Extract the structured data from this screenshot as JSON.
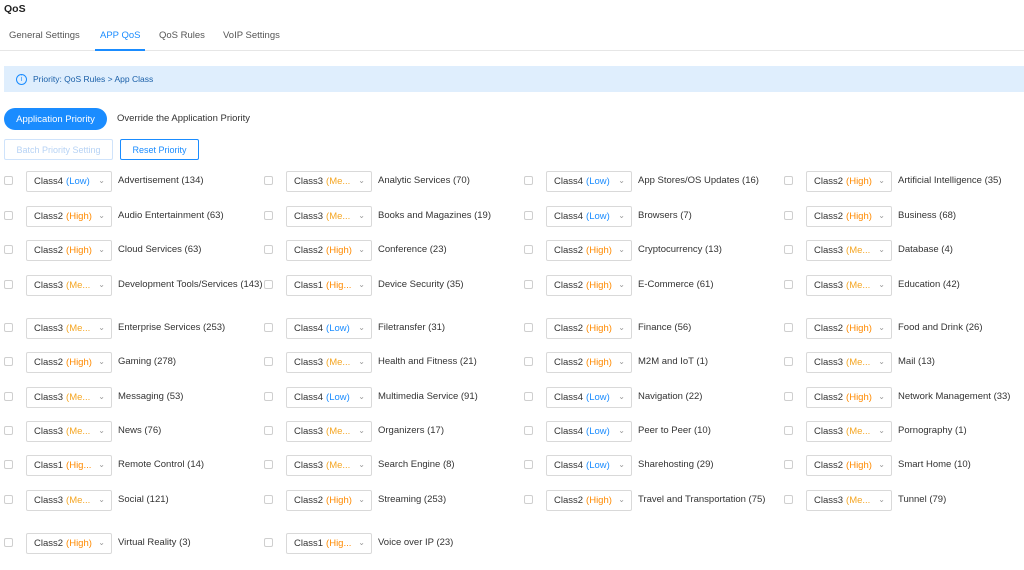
{
  "page_title": "QoS",
  "tabs": [
    {
      "label": "General Settings",
      "active": false
    },
    {
      "label": "APP QoS",
      "active": true
    },
    {
      "label": "QoS Rules",
      "active": false
    },
    {
      "label": "VoIP Settings",
      "active": false
    }
  ],
  "info": {
    "icon": "info-circle-icon",
    "text": "Priority: QoS Rules > App Class"
  },
  "mode": {
    "active": "Application Priority",
    "other": "Override the Application Priority"
  },
  "buttons": {
    "batch": "Batch Priority Setting",
    "reset": "Reset Priority"
  },
  "priority_colors": {
    "High": "#ff8a00",
    "Medium": "#f5a623",
    "Low": "#1a8cff"
  },
  "apps": [
    {
      "cls": "Class4",
      "pri": "Low",
      "pri_text": "(Low)",
      "name": "Advertisement (134)"
    },
    {
      "cls": "Class3",
      "pri": "Medium",
      "pri_text": "(Me...",
      "name": "Analytic Services (70)"
    },
    {
      "cls": "Class4",
      "pri": "Low",
      "pri_text": "(Low)",
      "name": "App Stores/OS Updates (16)"
    },
    {
      "cls": "Class2",
      "pri": "High",
      "pri_text": "(High)",
      "name": "Artificial Intelligence (35)"
    },
    {
      "cls": "Class2",
      "pri": "High",
      "pri_text": "(High)",
      "name": "Audio Entertainment (63)"
    },
    {
      "cls": "Class3",
      "pri": "Medium",
      "pri_text": "(Me...",
      "name": "Books and Magazines (19)"
    },
    {
      "cls": "Class4",
      "pri": "Low",
      "pri_text": "(Low)",
      "name": "Browsers (7)"
    },
    {
      "cls": "Class2",
      "pri": "High",
      "pri_text": "(High)",
      "name": "Business (68)"
    },
    {
      "cls": "Class2",
      "pri": "High",
      "pri_text": "(High)",
      "name": "Cloud Services (63)"
    },
    {
      "cls": "Class2",
      "pri": "High",
      "pri_text": "(High)",
      "name": "Conference (23)"
    },
    {
      "cls": "Class2",
      "pri": "High",
      "pri_text": "(High)",
      "name": "Cryptocurrency (13)"
    },
    {
      "cls": "Class3",
      "pri": "Medium",
      "pri_text": "(Me...",
      "name": "Database (4)"
    },
    {
      "cls": "Class3",
      "pri": "Medium",
      "pri_text": "(Me...",
      "name": "Development Tools/Services (143)"
    },
    {
      "cls": "Class1",
      "pri": "High",
      "pri_text": "(Hig...",
      "name": "Device Security (35)"
    },
    {
      "cls": "Class2",
      "pri": "High",
      "pri_text": "(High)",
      "name": "E-Commerce (61)"
    },
    {
      "cls": "Class3",
      "pri": "Medium",
      "pri_text": "(Me...",
      "name": "Education (42)"
    },
    {
      "cls": "Class3",
      "pri": "Medium",
      "pri_text": "(Me...",
      "name": "Enterprise Services (253)"
    },
    {
      "cls": "Class4",
      "pri": "Low",
      "pri_text": "(Low)",
      "name": "Filetransfer (31)"
    },
    {
      "cls": "Class2",
      "pri": "High",
      "pri_text": "(High)",
      "name": "Finance (56)"
    },
    {
      "cls": "Class2",
      "pri": "High",
      "pri_text": "(High)",
      "name": "Food and Drink (26)"
    },
    {
      "cls": "Class2",
      "pri": "High",
      "pri_text": "(High)",
      "name": "Gaming (278)"
    },
    {
      "cls": "Class3",
      "pri": "Medium",
      "pri_text": "(Me...",
      "name": "Health and Fitness (21)"
    },
    {
      "cls": "Class2",
      "pri": "High",
      "pri_text": "(High)",
      "name": "M2M and IoT (1)"
    },
    {
      "cls": "Class3",
      "pri": "Medium",
      "pri_text": "(Me...",
      "name": "Mail (13)"
    },
    {
      "cls": "Class3",
      "pri": "Medium",
      "pri_text": "(Me...",
      "name": "Messaging (53)"
    },
    {
      "cls": "Class4",
      "pri": "Low",
      "pri_text": "(Low)",
      "name": "Multimedia Service (91)"
    },
    {
      "cls": "Class4",
      "pri": "Low",
      "pri_text": "(Low)",
      "name": "Navigation (22)"
    },
    {
      "cls": "Class2",
      "pri": "High",
      "pri_text": "(High)",
      "name": "Network Management (33)"
    },
    {
      "cls": "Class3",
      "pri": "Medium",
      "pri_text": "(Me...",
      "name": "News (76)"
    },
    {
      "cls": "Class3",
      "pri": "Medium",
      "pri_text": "(Me...",
      "name": "Organizers (17)"
    },
    {
      "cls": "Class4",
      "pri": "Low",
      "pri_text": "(Low)",
      "name": "Peer to Peer (10)"
    },
    {
      "cls": "Class3",
      "pri": "Medium",
      "pri_text": "(Me...",
      "name": "Pornography (1)"
    },
    {
      "cls": "Class1",
      "pri": "High",
      "pri_text": "(Hig...",
      "name": "Remote Control (14)"
    },
    {
      "cls": "Class3",
      "pri": "Medium",
      "pri_text": "(Me...",
      "name": "Search Engine (8)"
    },
    {
      "cls": "Class4",
      "pri": "Low",
      "pri_text": "(Low)",
      "name": "Sharehosting (29)"
    },
    {
      "cls": "Class2",
      "pri": "High",
      "pri_text": "(High)",
      "name": "Smart Home (10)"
    },
    {
      "cls": "Class3",
      "pri": "Medium",
      "pri_text": "(Me...",
      "name": "Social (121)"
    },
    {
      "cls": "Class2",
      "pri": "High",
      "pri_text": "(High)",
      "name": "Streaming (253)"
    },
    {
      "cls": "Class2",
      "pri": "High",
      "pri_text": "(High)",
      "name": "Travel and Transportation (75)"
    },
    {
      "cls": "Class3",
      "pri": "Medium",
      "pri_text": "(Me...",
      "name": "Tunnel (79)"
    },
    {
      "cls": "Class2",
      "pri": "High",
      "pri_text": "(High)",
      "name": "Virtual Reality (3)"
    },
    {
      "cls": "Class1",
      "pri": "High",
      "pri_text": "(Hig...",
      "name": "Voice over IP (23)"
    }
  ]
}
